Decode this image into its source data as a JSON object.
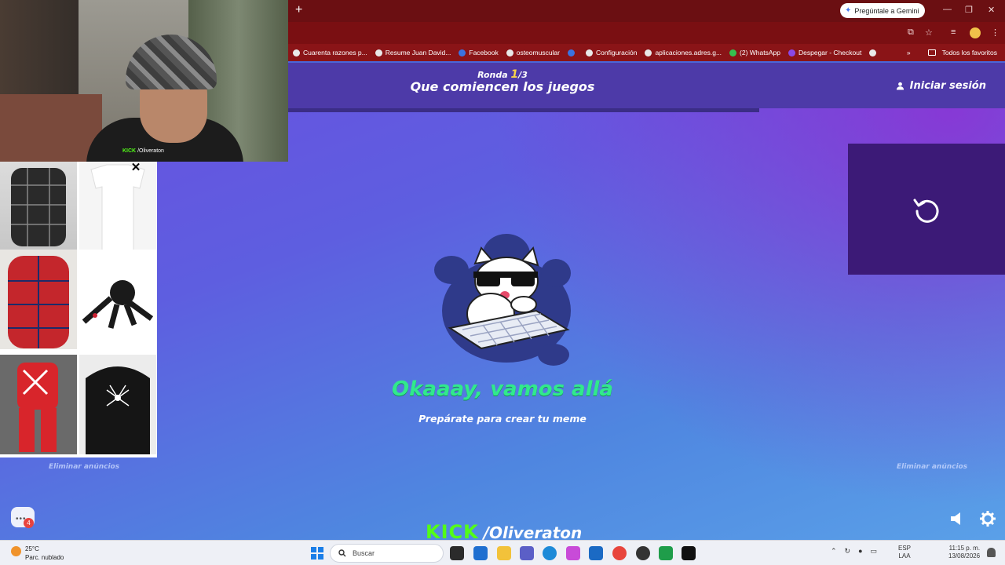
{
  "browser": {
    "new_tab_symbol": "+",
    "gemini_button": "Pregúntale a Gemini",
    "window_controls": [
      "—",
      "❐",
      "✕"
    ],
    "bookmarks": [
      {
        "label": "Cuarenta razones p...",
        "icon": "page-icon"
      },
      {
        "label": "Resume Juan David...",
        "icon": "ai-icon"
      },
      {
        "label": "Facebook",
        "icon": "facebook-icon"
      },
      {
        "label": "osteomuscular",
        "icon": "globe-icon"
      },
      {
        "label": "",
        "icon": "facebook-icon"
      },
      {
        "label": "Configuración",
        "icon": "gear-icon"
      },
      {
        "label": "aplicaciones.adres.g...",
        "icon": "globe-icon"
      },
      {
        "label": "(2) WhatsApp",
        "icon": "whatsapp-icon"
      },
      {
        "label": "Despegar - Checkout",
        "icon": "despegar-icon"
      },
      {
        "label": "",
        "icon": "google-icon"
      }
    ],
    "bookmarks_overflow": "»",
    "all_bookmarks": "Todos los favoritos"
  },
  "game": {
    "round_label": "Ronda",
    "round_current": "1",
    "round_total": "/3",
    "title": "Que comiencen los juegos",
    "login": "Iniciar sesión",
    "headline": "Okaaay, vamos allá",
    "subline": "Prepárate para crear tu meme",
    "remove_ads_left": "Eliminar anúncios",
    "remove_ads_right": "Eliminar anúncios",
    "chat_badge": "4"
  },
  "stream": {
    "webcam_label_logo": "KICK",
    "webcam_label_handle": "/Oliveraton",
    "brand_logo": "KICK",
    "brand_handle": "/Oliveraton"
  },
  "ad": {
    "close_symbol": "✕"
  },
  "taskbar": {
    "temperature": "25°C",
    "weather": "Parc. nublado",
    "search_placeholder": "Buscar",
    "lang_top": "ESP",
    "lang_bottom": "LAA",
    "time": "11:15 p. m.",
    "date": "13/08/2026",
    "notification_badge": "3"
  },
  "colors": {
    "accent_green": "#31e98c",
    "kick_green": "#53fc18",
    "chrome_red": "#7a0f12",
    "header_purple": "#4d3aa8"
  }
}
